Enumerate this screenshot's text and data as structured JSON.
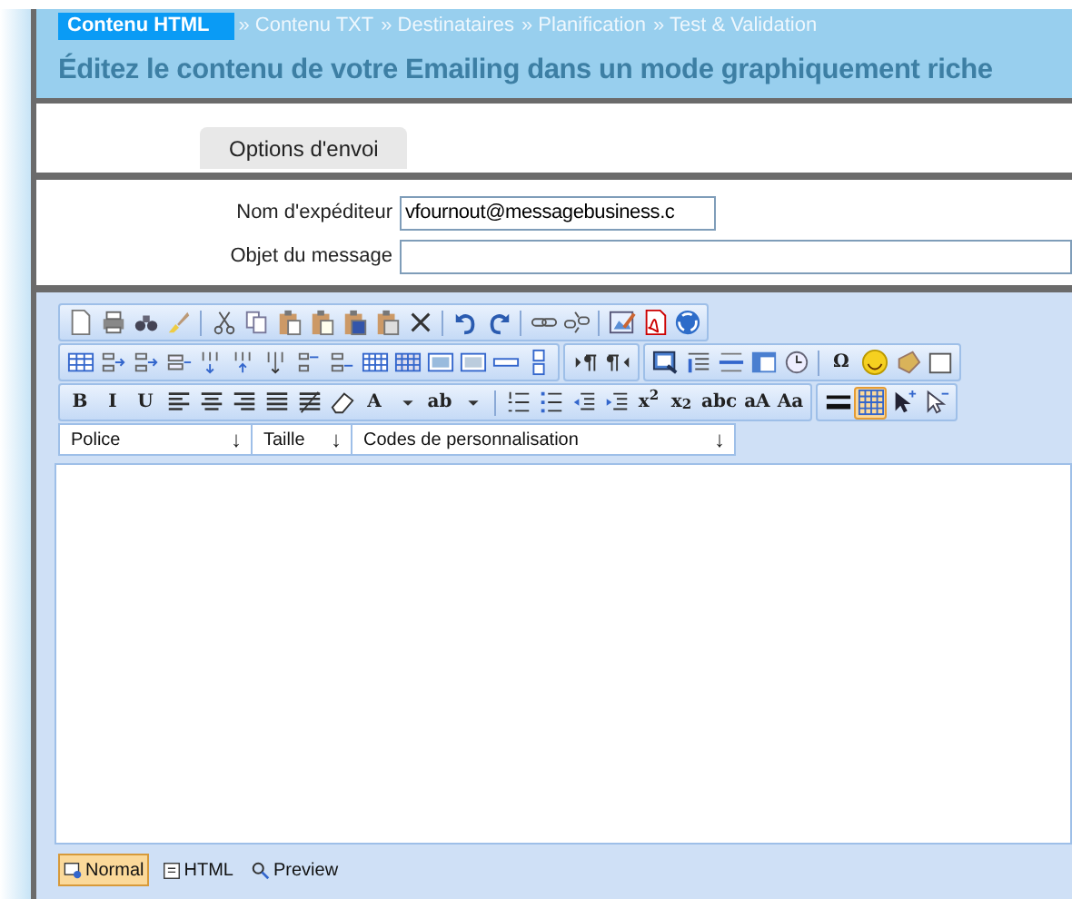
{
  "steps": [
    {
      "label": "Contenu HTML",
      "selected": true
    },
    {
      "label": "» Contenu TXT",
      "selected": false
    },
    {
      "label": "» Destinataires",
      "selected": false
    },
    {
      "label": "» Planification",
      "selected": false
    },
    {
      "label": "» Test & Validation",
      "selected": false
    }
  ],
  "page_title": "Éditez le contenu de votre Emailing dans un mode graphiquement riche",
  "tabs": [
    {
      "label": "Options d'envoi",
      "selected": true
    }
  ],
  "fields": [
    {
      "label": "Nom d'expéditeur",
      "value": "vfournout@messagebusiness.c"
    },
    {
      "label": "Objet du message"
    }
  ],
  "toolbar_rows": [
    {
      "groups": [
        [
          {
            "kind": "icon",
            "selected": false
          },
          {
            "kind": "icon",
            "selected": false
          },
          {
            "kind": "icon",
            "selected": false
          },
          {
            "kind": "icon",
            "selected": false
          },
          {
            "kind": "separator"
          },
          {
            "kind": "icon",
            "selected": false
          },
          {
            "kind": "icon",
            "selected": false
          },
          {
            "kind": "icon",
            "selected": false
          },
          {
            "kind": "icon",
            "selected": false
          },
          {
            "kind": "icon",
            "selected": false
          },
          {
            "kind": "icon",
            "selected": false
          },
          {
            "kind": "icon",
            "selected": false
          },
          {
            "kind": "separator"
          },
          {
            "kind": "icon",
            "selected": false
          },
          {
            "kind": "icon",
            "selected": false
          },
          {
            "kind": "separator"
          },
          {
            "kind": "icon",
            "selected": false
          },
          {
            "kind": "icon",
            "selected": false
          },
          {
            "kind": "separator"
          },
          {
            "kind": "icon",
            "selected": false
          },
          {
            "kind": "icon",
            "selected": false
          },
          {
            "kind": "icon",
            "selected": false
          }
        ]
      ]
    },
    {
      "groups": [
        [
          {
            "kind": "icon",
            "selected": false
          },
          {
            "kind": "icon",
            "selected": false
          },
          {
            "kind": "icon",
            "selected": false
          },
          {
            "kind": "icon",
            "selected": false
          },
          {
            "kind": "icon",
            "selected": false
          },
          {
            "kind": "icon",
            "selected": false
          },
          {
            "kind": "icon",
            "selected": false
          },
          {
            "kind": "icon",
            "selected": false
          },
          {
            "kind": "icon",
            "selected": false
          },
          {
            "kind": "icon",
            "selected": false
          },
          {
            "kind": "icon",
            "selected": false
          },
          {
            "kind": "icon",
            "selected": false
          },
          {
            "kind": "icon",
            "selected": false
          },
          {
            "kind": "icon",
            "selected": false
          },
          {
            "kind": "icon",
            "selected": false
          }
        ],
        [
          {
            "kind": "icon",
            "selected": false
          },
          {
            "kind": "icon",
            "selected": false
          }
        ],
        [
          {
            "kind": "icon",
            "selected": false
          },
          {
            "kind": "icon",
            "selected": false
          },
          {
            "kind": "icon",
            "selected": false
          },
          {
            "kind": "icon",
            "selected": false
          },
          {
            "kind": "icon",
            "selected": false
          },
          {
            "kind": "separator"
          },
          {
            "kind": "text",
            "text": "Ω",
            "selected": false
          },
          {
            "kind": "icon",
            "selected": false
          },
          {
            "kind": "icon",
            "selected": false
          },
          {
            "kind": "icon",
            "selected": false
          }
        ]
      ]
    },
    {
      "groups": [
        [
          {
            "kind": "text",
            "text": "B",
            "selected": false
          },
          {
            "kind": "text",
            "text": "I",
            "selected": false
          },
          {
            "kind": "text",
            "text": "U",
            "selected": false
          },
          {
            "kind": "icon",
            "selected": false
          },
          {
            "kind": "icon",
            "selected": false
          },
          {
            "kind": "icon",
            "selected": false
          },
          {
            "kind": "icon",
            "selected": false
          },
          {
            "kind": "icon",
            "selected": false
          },
          {
            "kind": "icon",
            "selected": false
          },
          {
            "kind": "text",
            "text": "A",
            "selected": false
          },
          {
            "kind": "icon",
            "selected": false
          },
          {
            "kind": "text",
            "text": "ab",
            "selected": false
          },
          {
            "kind": "icon",
            "selected": false
          },
          {
            "kind": "separator"
          },
          {
            "kind": "icon",
            "selected": false
          },
          {
            "kind": "icon",
            "selected": false
          },
          {
            "kind": "icon",
            "selected": false
          },
          {
            "kind": "icon",
            "selected": false
          },
          {
            "kind": "text",
            "text": "x$^{2}$",
            "selected": false
          },
          {
            "kind": "text",
            "text": "x$_{2}$",
            "selected": false
          },
          {
            "kind": "text",
            "text": "abc",
            "selected": false
          },
          {
            "kind": "text",
            "text": "aA",
            "selected": false
          },
          {
            "kind": "text",
            "text": "Aa",
            "selected": false
          }
        ],
        [
          {
            "kind": "icon",
            "selected": false
          },
          {
            "kind": "icon",
            "selected": true
          },
          {
            "kind": "icon",
            "selected": false
          },
          {
            "kind": "icon",
            "selected": false
          }
        ]
      ]
    }
  ],
  "dropdowns": [
    {
      "label": "Police",
      "arrow": "↓"
    },
    {
      "label": "Taille",
      "arrow": "↓"
    },
    {
      "label": "Codes de personnalisation",
      "arrow": "↓"
    }
  ],
  "modes": [
    {
      "label": "Normal",
      "selected": true
    },
    {
      "label": "HTML",
      "selected": false
    },
    {
      "label": "Preview",
      "selected": false
    }
  ]
}
